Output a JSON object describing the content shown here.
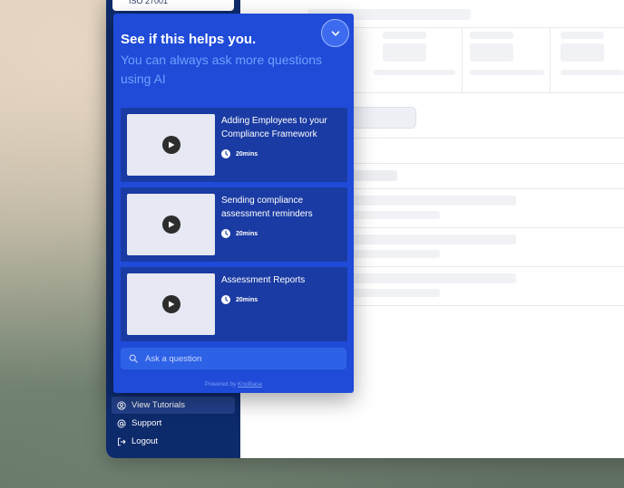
{
  "app": {
    "compliance_chip": "ISO 27001",
    "sidebar_nav": [
      {
        "label": "View Tutorials",
        "icon": "user-circle-icon",
        "active": true
      },
      {
        "label": "Support",
        "icon": "at-sign-icon",
        "active": false
      },
      {
        "label": "Logout",
        "icon": "logout-icon",
        "active": false
      }
    ]
  },
  "help_panel": {
    "title": "See if this helps you.",
    "subtitle": "You can always ask more questions using AI",
    "collapse_icon": "chevron-down-icon",
    "tutorials": [
      {
        "title": "Adding Employees to your Compliance Framework",
        "duration": "20mins"
      },
      {
        "title": "Sending compliance assessment reminders",
        "duration": "20mins"
      },
      {
        "title": "Assessment Reports",
        "duration": "20mins"
      }
    ],
    "ask": {
      "placeholder": "Ask a question",
      "value": ""
    },
    "powered_by": "Powered by",
    "powered_brand": "Knolbase"
  },
  "colors": {
    "panel": "#1f4bd8",
    "card": "#1a3ba3",
    "sidebar": "#0d2a6b",
    "subtitle": "#6ea0ff"
  }
}
